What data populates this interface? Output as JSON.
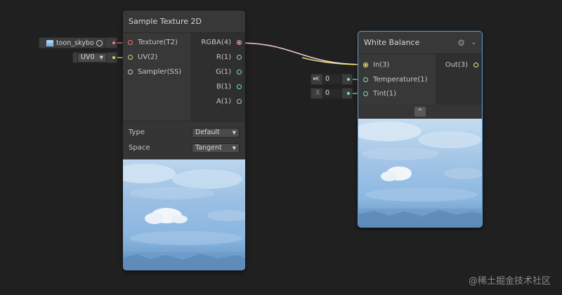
{
  "sample_node": {
    "title": "Sample Texture 2D",
    "inputs": [
      "Texture(T2)",
      "UV(2)",
      "Sampler(SS)"
    ],
    "outputs": [
      "RGBA(4)",
      "R(1)",
      "G(1)",
      "B(1)",
      "A(1)"
    ],
    "type_label": "Type",
    "type_value": "Default",
    "space_label": "Space",
    "space_value": "Tangent"
  },
  "texture_field": {
    "value": "toon_skybo",
    "icon": "texture-icon"
  },
  "uv_field": {
    "value": "UV0"
  },
  "wb_node": {
    "title": "White Balance",
    "inputs": [
      "In(3)",
      "Temperature(1)",
      "Tint(1)"
    ],
    "outputs": [
      "Out(3)"
    ],
    "collapse_glyph": "^"
  },
  "temperature_field": {
    "axis": "X",
    "value": "0"
  },
  "tint_field": {
    "axis": "X",
    "value": "0"
  },
  "watermark": "@稀土掘金技术社区",
  "colors": {
    "texture_port": "#f07878",
    "vector2_port": "#b8e06a",
    "vector3_port": "#f5f077",
    "vector4_port": "#f0a0d8",
    "vector1_port": "#7ae0c8",
    "selected_border": "#5e9fd6"
  }
}
